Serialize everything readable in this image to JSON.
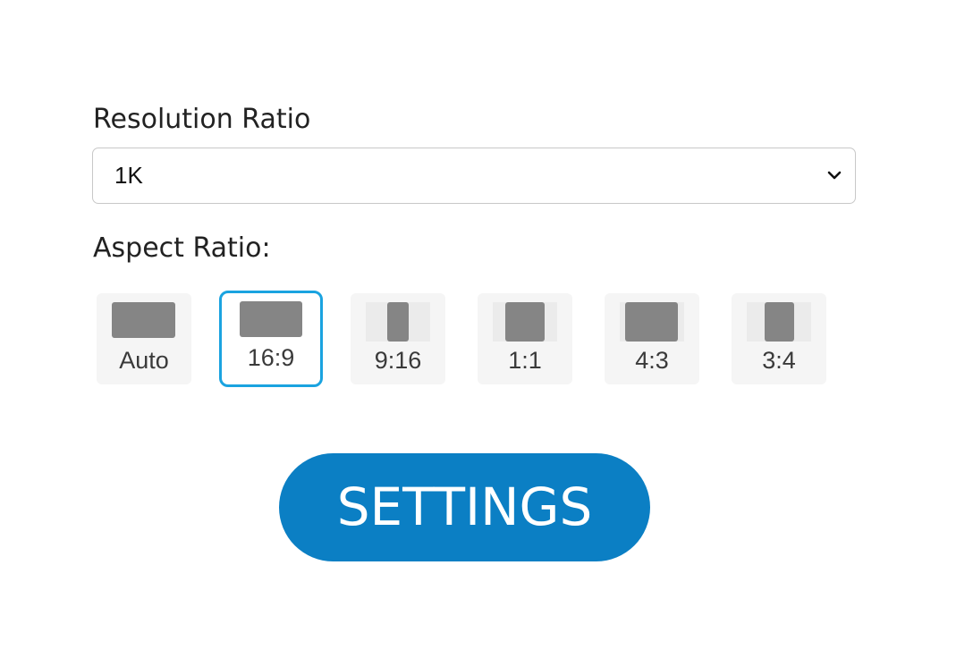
{
  "resolution": {
    "label": "Resolution Ratio",
    "selected_value": "1K",
    "icon": "chevron-down-icon"
  },
  "aspect": {
    "label": "Aspect Ratio:",
    "selected": "16:9",
    "options": [
      {
        "label": "Auto",
        "icon": "aspect-auto-icon"
      },
      {
        "label": "16:9",
        "icon": "aspect-16-9-icon"
      },
      {
        "label": "9:16",
        "icon": "aspect-9-16-icon"
      },
      {
        "label": "1:1",
        "icon": "aspect-1-1-icon"
      },
      {
        "label": "4:3",
        "icon": "aspect-4-3-icon"
      },
      {
        "label": "3:4",
        "icon": "aspect-3-4-icon"
      }
    ]
  },
  "settings_button": {
    "label": "SETTINGS"
  },
  "colors": {
    "accent_border": "#1aa3e0",
    "button_bg": "#0b7fc4",
    "icon_fill": "#858585",
    "tile_bg": "#f5f5f5"
  }
}
